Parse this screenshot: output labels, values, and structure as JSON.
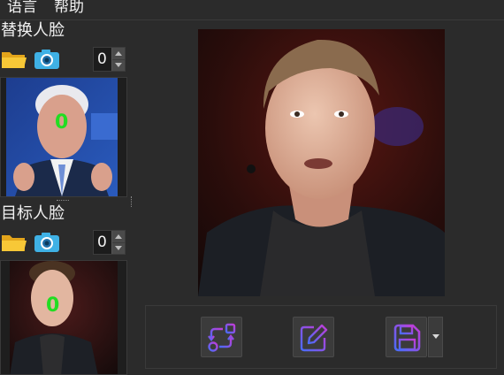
{
  "menubar": {
    "items": [
      {
        "label": "语言"
      },
      {
        "label": "帮助"
      }
    ]
  },
  "source_panel": {
    "label": "替换人脸",
    "face_index": "0",
    "face_marker": "0",
    "open_icon": "folder-icon",
    "camera_icon": "camera-icon"
  },
  "target_panel": {
    "label": "目标人脸",
    "face_index": "0",
    "face_marker": "0",
    "open_icon": "folder-icon",
    "camera_icon": "camera-icon"
  },
  "toolbar": {
    "buttons": [
      {
        "icon": "swap-icon"
      },
      {
        "icon": "edit-icon"
      },
      {
        "icon": "save-icon"
      }
    ],
    "save_dropdown_icon": "chevron-down-icon"
  },
  "colors": {
    "background": "#2b2b2b",
    "accent_gradient_start": "#4a6cf7",
    "accent_gradient_end": "#c23cd6",
    "face_marker": "#22dd22"
  }
}
